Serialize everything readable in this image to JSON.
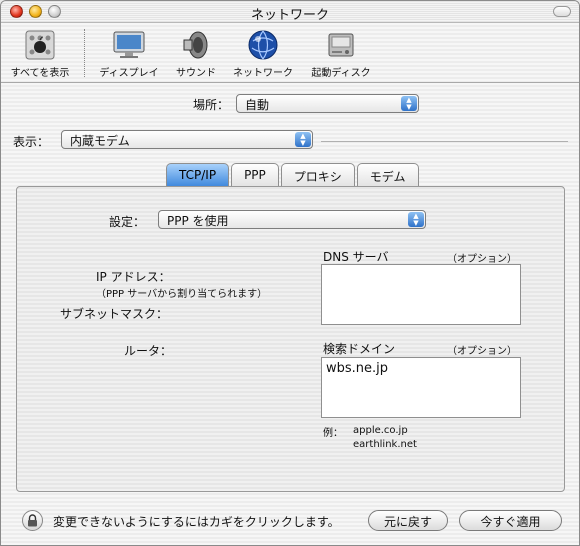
{
  "window": {
    "title": "ネットワーク"
  },
  "toolbar": {
    "items": [
      {
        "label": "すべてを表示",
        "icon": "show-all-icon"
      },
      {
        "label": "ディスプレイ",
        "icon": "display-icon"
      },
      {
        "label": "サウンド",
        "icon": "sound-icon"
      },
      {
        "label": "ネットワーク",
        "icon": "network-icon"
      },
      {
        "label": "起動ディスク",
        "icon": "startup-disk-icon"
      }
    ]
  },
  "location": {
    "label": "場所：",
    "value": "自動"
  },
  "show": {
    "label": "表示：",
    "value": "内蔵モデム"
  },
  "tabs": [
    {
      "label": "TCP/IP",
      "active": true
    },
    {
      "label": "PPP",
      "active": false
    },
    {
      "label": "プロキシ",
      "active": false
    },
    {
      "label": "モデム",
      "active": false
    }
  ],
  "tcpip": {
    "configure_label": "設定：",
    "configure_value": "PPP を使用",
    "ip_label": "IP アドレス：",
    "ip_note": "（PPP サーバから割り当てられます）",
    "subnet_label": "サブネットマスク：",
    "router_label": "ルータ：",
    "dns_label": "DNS サーバ",
    "dns_optional": "（オプション）",
    "dns_value": "",
    "search_label": "検索ドメイン",
    "search_optional": "（オプション）",
    "search_value": "wbs.ne.jp",
    "example_label": "例：",
    "example_1": "apple.co.jp",
    "example_2": "earthlink.net"
  },
  "footer": {
    "lock_text": "変更できないようにするにはカギをクリックします。",
    "revert_label": "元に戻す",
    "apply_label": "今すぐ適用"
  },
  "colors": {
    "accent": "#3c86dc",
    "tab_active_top": "#a8d1fb"
  }
}
